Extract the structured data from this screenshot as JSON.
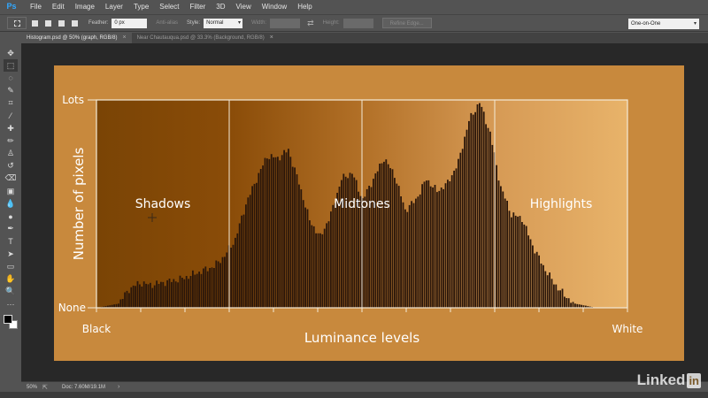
{
  "app": {
    "logo": "Ps",
    "menu": [
      "File",
      "Edit",
      "Image",
      "Layer",
      "Type",
      "Select",
      "Filter",
      "3D",
      "View",
      "Window",
      "Help"
    ]
  },
  "options": {
    "feather_label": "Feather:",
    "feather_value": "0 px",
    "anti_alias_label": "Anti-alias",
    "style_label": "Style:",
    "style_value": "Normal",
    "width_label": "Width:",
    "height_label": "Height:",
    "refine_edge": "Refine Edge...",
    "workspace": "One-on-One"
  },
  "tabs": [
    {
      "label": "Histogram.psd @ 50% (graph, RGB/8)",
      "close": "×"
    },
    {
      "label": "Near Chautauqua.psd @ 33.3% (Background, RGB/8)",
      "close": "×"
    }
  ],
  "tools": [
    "move-icon",
    "marquee-icon",
    "lasso-icon",
    "quick-select-icon",
    "crop-icon",
    "eyedropper-icon",
    "healing-icon",
    "brush-icon",
    "stamp-icon",
    "history-brush-icon",
    "eraser-icon",
    "gradient-icon",
    "blur-icon",
    "dodge-icon",
    "pen-icon",
    "type-icon",
    "path-select-icon",
    "rectangle-icon",
    "hand-icon",
    "zoom-icon",
    "more-tools-icon"
  ],
  "tool_glyphs": [
    "✥",
    "⬚",
    "◌",
    "✎",
    "⌗",
    "⁄",
    "✚",
    "✏",
    "♙",
    "↺",
    "⌫",
    "▣",
    "💧",
    "●",
    "✒",
    "T",
    "➤",
    "▭",
    "✋",
    "🔍",
    "···"
  ],
  "status": {
    "zoom": "50%",
    "doc": "Doc: 7.60M/19.1M",
    "arrow": "›"
  },
  "watermark": {
    "text": "Linked",
    "badge": "in"
  },
  "chart_data": {
    "type": "area",
    "y_top_label": "Lots",
    "y_bottom_label": "None",
    "ylabel": "Number of pixels",
    "x_left_label": "Black",
    "x_right_label": "White",
    "xlabel": "Luminance levels",
    "regions": [
      "Shadows",
      "Midtones",
      "Highlights"
    ],
    "x": [
      0,
      0.02,
      0.04,
      0.06,
      0.08,
      0.1,
      0.12,
      0.14,
      0.16,
      0.18,
      0.2,
      0.22,
      0.24,
      0.26,
      0.28,
      0.3,
      0.32,
      0.34,
      0.36,
      0.38,
      0.4,
      0.42,
      0.44,
      0.46,
      0.48,
      0.5,
      0.52,
      0.54,
      0.56,
      0.58,
      0.6,
      0.62,
      0.64,
      0.66,
      0.68,
      0.7,
      0.72,
      0.74,
      0.76,
      0.78,
      0.8,
      0.82,
      0.84,
      0.86,
      0.88,
      0.9,
      0.92,
      0.94,
      0.96,
      0.98,
      1
    ],
    "y": [
      0,
      0.01,
      0.02,
      0.09,
      0.12,
      0.11,
      0.12,
      0.13,
      0.14,
      0.16,
      0.18,
      0.2,
      0.25,
      0.33,
      0.5,
      0.62,
      0.73,
      0.72,
      0.76,
      0.6,
      0.42,
      0.34,
      0.45,
      0.62,
      0.65,
      0.52,
      0.62,
      0.72,
      0.64,
      0.47,
      0.52,
      0.62,
      0.56,
      0.6,
      0.7,
      0.9,
      0.99,
      0.84,
      0.58,
      0.45,
      0.43,
      0.3,
      0.2,
      0.12,
      0.06,
      0.02,
      0.01,
      0,
      0,
      0,
      0
    ],
    "xlim": [
      0,
      1
    ],
    "ylim": [
      0,
      1
    ],
    "colors": {
      "bars": "#2a160a",
      "frame": "#f4ead8",
      "background": "#c8893d"
    }
  }
}
